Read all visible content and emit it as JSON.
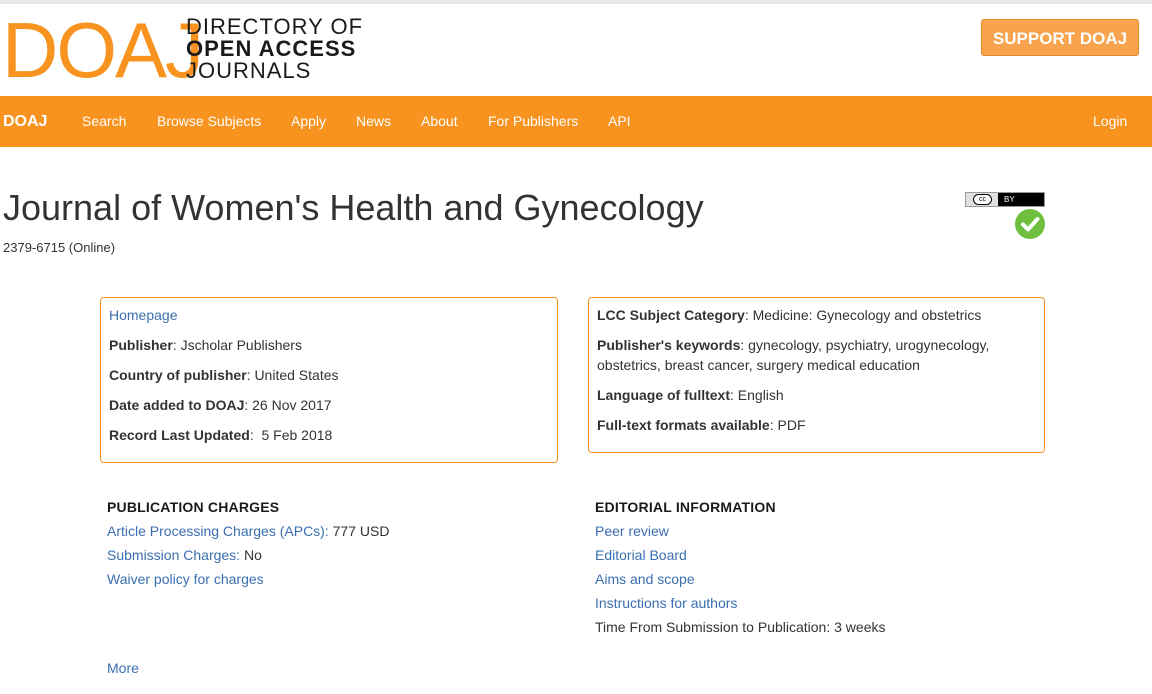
{
  "header": {
    "logo_mark": "DOAJ",
    "logo_line1": "DIRECTORY OF",
    "logo_line2": "OPEN ACCESS",
    "logo_line3": "JOURNALS",
    "support_label": "SUPPORT DOAJ"
  },
  "nav": {
    "brand": "DOAJ",
    "items": [
      "Search",
      "Browse Subjects",
      "Apply",
      "News",
      "About",
      "For Publishers",
      "API"
    ],
    "login": "Login"
  },
  "journal": {
    "title": "Journal of Women's Health and Gynecology",
    "issn": "2379-6715 (Online)",
    "license_badge": "BY",
    "license_cc": "cc",
    "seal_icon": "doaj-seal-check-icon"
  },
  "left_box": {
    "homepage_link": "Homepage",
    "publisher_label": "Publisher",
    "publisher_value": ": Jscholar Publishers",
    "country_label": "Country of publisher",
    "country_value": ": United States",
    "date_added_label": "Date added to DOAJ",
    "date_added_value": ": 26 Nov 2017",
    "updated_label": "Record Last Updated",
    "updated_value": ":  5 Feb 2018"
  },
  "right_box": {
    "lcc_label": "LCC Subject Category",
    "lcc_value": ": Medicine: Gynecology and obstetrics",
    "keywords_label": "Publisher's keywords",
    "keywords_value_line1": ": gynecology, psychiatry, urogynecology,",
    "keywords_value_line2": "obstetrics, breast cancer, surgery medical education",
    "language_label": "Language of fulltext",
    "language_value": ": English",
    "formats_label": "Full-text formats available",
    "formats_value": ": PDF"
  },
  "publication_charges": {
    "heading": "PUBLICATION CHARGES",
    "apc_link": "Article Processing Charges (APCs):",
    "apc_value": " 777 USD",
    "submission_link": "Submission Charges:",
    "submission_value": " No",
    "waiver_link": "Waiver policy for charges"
  },
  "editorial": {
    "heading": "EDITORIAL INFORMATION",
    "peer_review": "Peer review",
    "editorial_board": "Editorial Board",
    "aims_scope": "Aims and scope",
    "instructions": "Instructions for authors",
    "time_to_pub": "Time From Submission to Publication: 3 weeks"
  },
  "more_link": "More",
  "colors": {
    "brand_orange": "#f7931e",
    "link_blue": "#3a6fb0",
    "seal_green": "#6fbf3f"
  }
}
